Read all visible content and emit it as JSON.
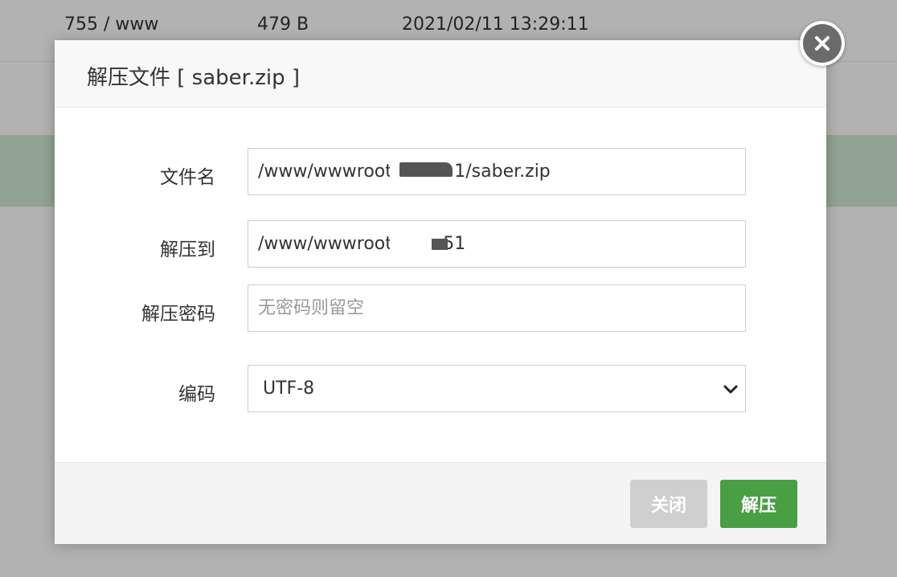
{
  "background": {
    "file_row": {
      "permission": "755 / www",
      "size": "479 B",
      "modified": "2021/02/11 13:29:11"
    }
  },
  "dialog": {
    "title": "解压文件 [ saber.zip ]",
    "close_icon": "close-icon",
    "fields": {
      "filename": {
        "label": "文件名",
        "value": "/www/wwwroot/.105.51/saber.zip"
      },
      "extract_to": {
        "label": "解压到",
        "value": "/www/wwwroot/.105.51"
      },
      "password": {
        "label": "解压密码",
        "value": "",
        "placeholder": "无密码则留空"
      },
      "encoding": {
        "label": "编码",
        "options": [
          "UTF-8"
        ],
        "selected": "UTF-8"
      }
    },
    "buttons": {
      "close_label": "关闭",
      "extract_label": "解压"
    }
  },
  "colors": {
    "primary_button": "#4a9f45",
    "secondary_button": "#cfcfcf",
    "close_icon_bg": "#6b6b6b"
  }
}
